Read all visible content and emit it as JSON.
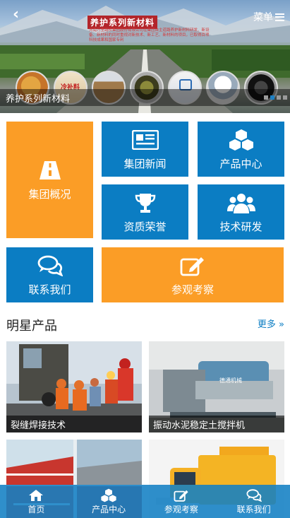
{
  "header": {
    "back_icon": "chevron-left-icon",
    "menu_label": "菜单"
  },
  "banner": {
    "title": "养护系列新材料",
    "description": "河南万里路桥集团股份有限公司在集团自主道路养护新材料研发、新设备、新材料的同时重视对新技术、新工艺、新材料的项目，已取得百项科技成果和国家专利",
    "caption": "养护系列新材料",
    "dots": 4,
    "active_dot": 1
  },
  "tiles": [
    {
      "label": "集团概况",
      "icon": "road-icon",
      "color": "#fb9d26"
    },
    {
      "label": "集团新闻",
      "icon": "newspaper-icon",
      "color": "#0b7dc3"
    },
    {
      "label": "产品中心",
      "icon": "cubes-icon",
      "color": "#0b7dc3"
    },
    {
      "label": "资质荣誉",
      "icon": "trophy-icon",
      "color": "#0b7dc3"
    },
    {
      "label": "技术研发",
      "icon": "users-icon",
      "color": "#0b7dc3"
    },
    {
      "label": "联系我们",
      "icon": "chat-icon",
      "color": "#0b7dc3"
    },
    {
      "label": "参观考察",
      "icon": "edit-icon",
      "color": "#fb9d26"
    }
  ],
  "products_section": {
    "title": "明星产品",
    "more_label": "更多 »",
    "items": [
      {
        "caption": "裂缝焊接技术"
      },
      {
        "caption": "振动水泥稳定土搅拌机"
      },
      {
        "caption": ""
      },
      {
        "caption": ""
      }
    ]
  },
  "bottom_nav": [
    {
      "label": "首页",
      "icon": "home-icon"
    },
    {
      "label": "产品中心",
      "icon": "cubes-icon"
    },
    {
      "label": "参观考察",
      "icon": "edit-icon"
    },
    {
      "label": "联系我们",
      "icon": "chat-icon"
    }
  ]
}
